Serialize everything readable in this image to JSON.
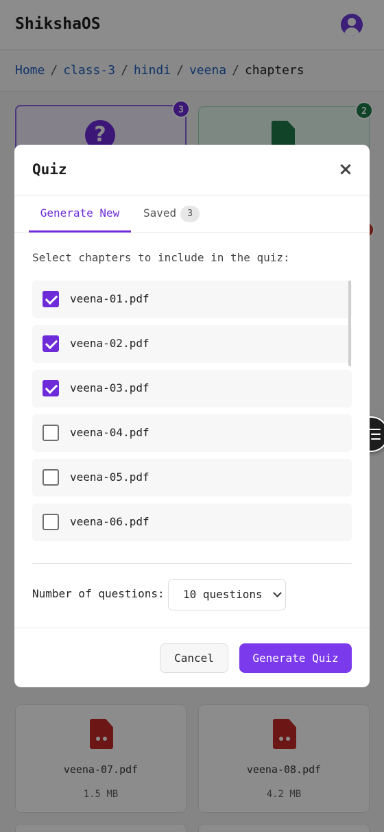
{
  "app": {
    "title": "ShikshaOS"
  },
  "breadcrumb": {
    "items": [
      "Home",
      "class-3",
      "hindi",
      "veena",
      "chapters"
    ],
    "separator": "/"
  },
  "background": {
    "quiz_badge_count": "3",
    "notes_badge_count": "2",
    "quiz_icon_glyph": "?",
    "files": [
      {
        "name": "veena-07.pdf",
        "size": "1.5 MB"
      },
      {
        "name": "veena-08.pdf",
        "size": "4.2 MB"
      }
    ]
  },
  "modal": {
    "title": "Quiz",
    "close_glyph": "×",
    "tabs": [
      {
        "label": "Generate New"
      },
      {
        "label": "Saved",
        "count": "3"
      }
    ],
    "instruction": "Select chapters to include in the quiz:",
    "chapters": [
      {
        "name": "veena-01.pdf",
        "checked": true
      },
      {
        "name": "veena-02.pdf",
        "checked": true
      },
      {
        "name": "veena-03.pdf",
        "checked": true
      },
      {
        "name": "veena-04.pdf",
        "checked": false
      },
      {
        "name": "veena-05.pdf",
        "checked": false
      },
      {
        "name": "veena-06.pdf",
        "checked": false
      }
    ],
    "num_questions_label": "Number of questions:",
    "num_questions_value": "10 questions",
    "cancel_label": "Cancel",
    "generate_label": "Generate Quiz"
  },
  "colors": {
    "accent": "#7c3aed",
    "accent_dark": "#6d2bd9",
    "success": "#1e7a4a",
    "danger": "#c62828"
  },
  "icons": [
    "user-avatar-icon",
    "question-circle-icon",
    "document-icon",
    "pdf-file-icon",
    "close-icon",
    "chevron-down-icon",
    "checkmark-icon",
    "reader-list-icon"
  ]
}
